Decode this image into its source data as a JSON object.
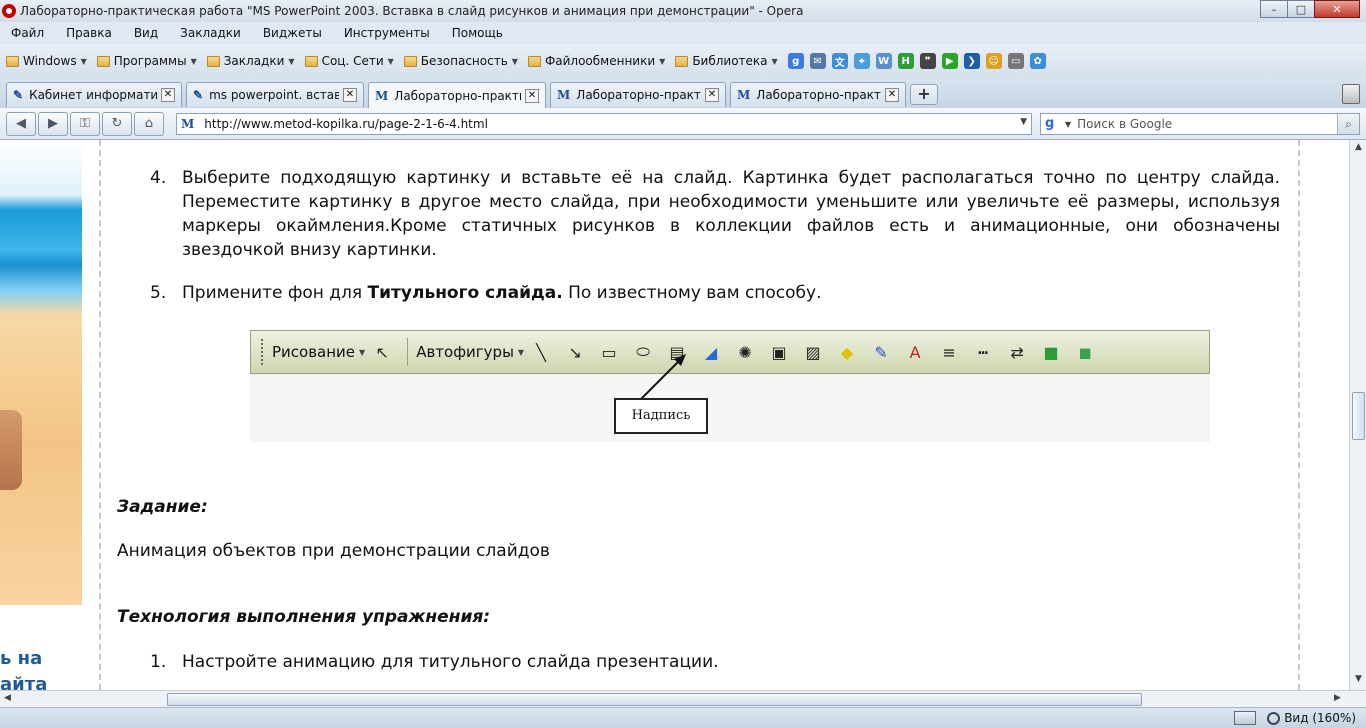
{
  "window": {
    "title": "Лабораторно-практическая работа \"MS PowerPoint 2003. Вставка в слайд рисунков и анимация при демонстрации\" - Opera",
    "minimize": "–",
    "maximize": "□",
    "close": "✕"
  },
  "menu": [
    "Файл",
    "Правка",
    "Вид",
    "Закладки",
    "Виджеты",
    "Инструменты",
    "Помощь"
  ],
  "bookmarks": [
    "Windows",
    "Программы",
    "Закладки",
    "Соц. Сети",
    "Безопасность",
    "Файлообменники",
    "Библиотека"
  ],
  "quick_icons": [
    {
      "name": "google-icon",
      "glyph": "g",
      "color": "#3c7be0"
    },
    {
      "name": "mail-icon",
      "glyph": "✉",
      "color": "#5577aa"
    },
    {
      "name": "translate-icon",
      "glyph": "文",
      "color": "#3a8fd8"
    },
    {
      "name": "map-icon",
      "glyph": "⌖",
      "color": "#4aa0d8"
    },
    {
      "name": "wikipedia-icon",
      "glyph": "W",
      "color": "#5a8fd0"
    },
    {
      "name": "h-icon",
      "glyph": "H",
      "color": "#2e9e3a"
    },
    {
      "name": "quote-icon",
      "glyph": "❞",
      "color": "#444444"
    },
    {
      "name": "play-icon",
      "glyph": "▶",
      "color": "#2da52d"
    },
    {
      "name": "forward-icon",
      "glyph": "❯",
      "color": "#1e5ea8"
    },
    {
      "name": "smiley-icon",
      "glyph": "☺",
      "color": "#e0a020"
    },
    {
      "name": "page-icon",
      "glyph": "▭",
      "color": "#777777"
    },
    {
      "name": "flower-icon",
      "glyph": "✿",
      "color": "#3a8fd8"
    }
  ],
  "tabs": [
    {
      "label": "Кабинет информатик...",
      "fav": "✎",
      "active": false
    },
    {
      "label": "ms powerpoint. вставк...",
      "fav": "✎",
      "active": false
    },
    {
      "label": "Лабораторно-практи...",
      "fav": "M",
      "active": true
    },
    {
      "label": "Лабораторно-практи...",
      "fav": "M",
      "active": false
    },
    {
      "label": "Лабораторно-практи...",
      "fav": "M",
      "active": false
    }
  ],
  "address": {
    "url": "http://www.metod-kopilka.ru/page-2-1-6-4.html",
    "fav": "M",
    "search_placeholder": "Поиск в Google"
  },
  "content": {
    "item4_num": "4.",
    "item4_text": "Выберите подходящую картинку и вставьте её на слайд. Картинка будет располагаться точно по центру слайда. Переместите картинку в другое место слайда, при необходимости уменьшите или увеличьте её размеры, используя маркеры окаймления.Кроме статичных рисунков в коллекции файлов есть и анимационные, они обозначены звездочкой внизу картинки.",
    "item5_num": "5.",
    "item5_pre": "Примените фон для ",
    "item5_bold": "Титульного слайда.",
    "item5_post": " По известному вам способу.",
    "task_heading": "Задание:",
    "task_text": "Анимация объектов при демонстрации слайдов",
    "tech_heading": "Технология выполнения упражнения:",
    "step1_num": "1.",
    "step1_text": "Настройте анимацию для титульного слайда презентации."
  },
  "drawing_toolbar": {
    "draw_label": "Рисование",
    "autoshapes_label": "Автофигуры",
    "callout_label": "Надпись",
    "tools": [
      {
        "name": "select-pointer-icon",
        "glyph": "↖"
      },
      {
        "name": "line-icon",
        "glyph": "╲"
      },
      {
        "name": "arrow-icon",
        "glyph": "↘"
      },
      {
        "name": "rectangle-icon",
        "glyph": "▭"
      },
      {
        "name": "oval-icon",
        "glyph": "⬭"
      },
      {
        "name": "textbox-icon",
        "glyph": "▤"
      },
      {
        "name": "wordart-icon",
        "glyph": "◢"
      },
      {
        "name": "diagram-icon",
        "glyph": "✺"
      },
      {
        "name": "clipart-icon",
        "glyph": "▣"
      },
      {
        "name": "picture-icon",
        "glyph": "▨"
      },
      {
        "name": "fill-color-icon",
        "glyph": "◆"
      },
      {
        "name": "line-color-icon",
        "glyph": "✎"
      },
      {
        "name": "font-color-icon",
        "glyph": "A"
      },
      {
        "name": "line-style-icon",
        "glyph": "≡"
      },
      {
        "name": "dash-style-icon",
        "glyph": "┅"
      },
      {
        "name": "arrow-style-icon",
        "glyph": "⇄"
      },
      {
        "name": "shadow-icon",
        "glyph": "■"
      },
      {
        "name": "3d-icon",
        "glyph": "◼"
      }
    ]
  },
  "sidebar": {
    "link_line1": "ь на",
    "link_line2": "айта"
  },
  "status": {
    "zoom": "Вид (160%)"
  }
}
